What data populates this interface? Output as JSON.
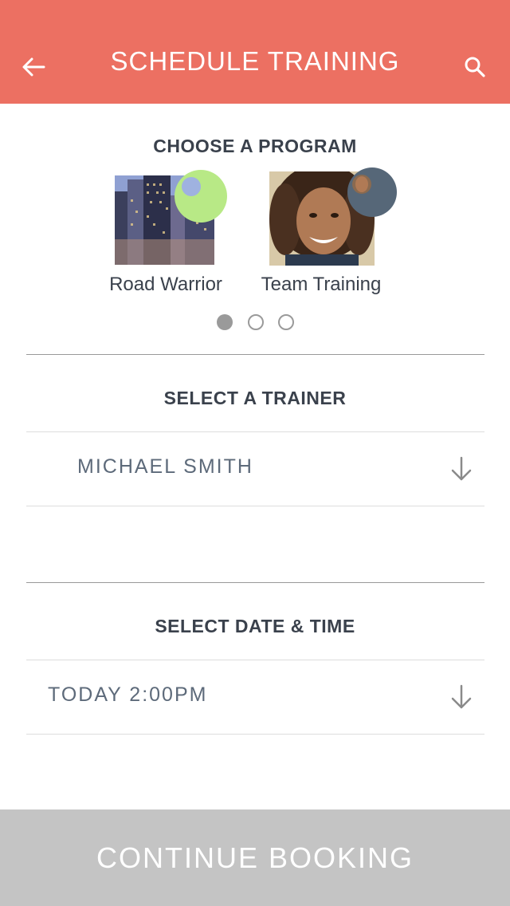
{
  "header": {
    "title": "SCHEDULE TRAINING",
    "back_icon": "arrow-left-icon",
    "search_icon": "search-icon",
    "background": "#ec7062"
  },
  "program_section": {
    "title": "CHOOSE A PROGRAM",
    "programs": [
      {
        "label": "Road Warrior",
        "badge_color": "#b8e986"
      },
      {
        "label": "Team Training",
        "badge_color": "#566778"
      }
    ],
    "pagination": {
      "pages": 3,
      "active": 1
    }
  },
  "trainer_section": {
    "title": "SELECT A TRAINER",
    "selected": "MICHAEL SMITH",
    "icon": "arrow-down-icon"
  },
  "datetime_section": {
    "title": "SELECT DATE & TIME",
    "selected": "TODAY 2:00PM",
    "icon": "arrow-down-icon"
  },
  "footer": {
    "button_label": "CONTINUE BOOKING",
    "background": "#c4c4c4"
  }
}
